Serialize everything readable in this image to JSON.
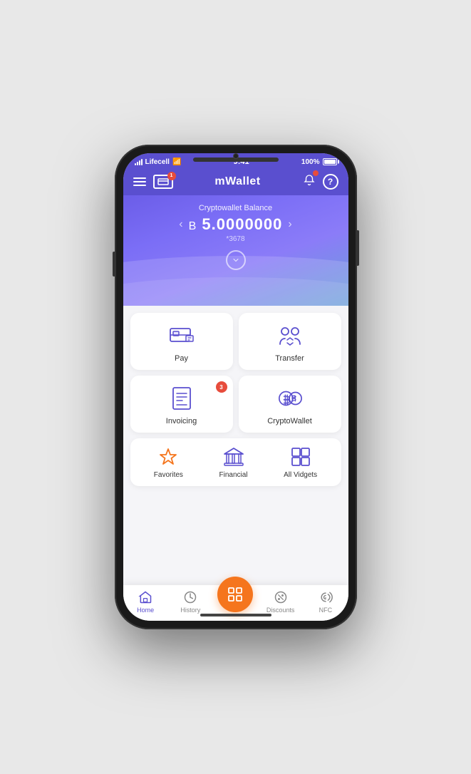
{
  "status_bar": {
    "carrier": "Lifecell",
    "time": "9:41",
    "battery": "100%",
    "signal_bars": 4
  },
  "header": {
    "title": "mWallet",
    "card_badge": "1",
    "notif_badge": "1"
  },
  "balance": {
    "label": "Cryptowallet Balance",
    "symbol": "B",
    "amount": "5.0000000",
    "account": "*3678"
  },
  "cards": [
    {
      "id": "pay",
      "label": "Pay",
      "badge": null
    },
    {
      "id": "transfer",
      "label": "Transfer",
      "badge": null
    },
    {
      "id": "invoicing",
      "label": "Invoicing",
      "badge": "3"
    },
    {
      "id": "cryptowallet",
      "label": "CryptoWallet",
      "badge": null
    }
  ],
  "widgets": [
    {
      "id": "favorites",
      "label": "Favorites"
    },
    {
      "id": "financial",
      "label": "Financial"
    },
    {
      "id": "all-vidgets",
      "label": "All Vidgets"
    }
  ],
  "bottom_nav": [
    {
      "id": "home",
      "label": "Home",
      "active": true
    },
    {
      "id": "history",
      "label": "History",
      "active": false
    },
    {
      "id": "scan",
      "label": "",
      "active": false,
      "is_scan": true
    },
    {
      "id": "discounts",
      "label": "Discounts",
      "active": false
    },
    {
      "id": "nfc",
      "label": "NFC",
      "active": false
    }
  ]
}
